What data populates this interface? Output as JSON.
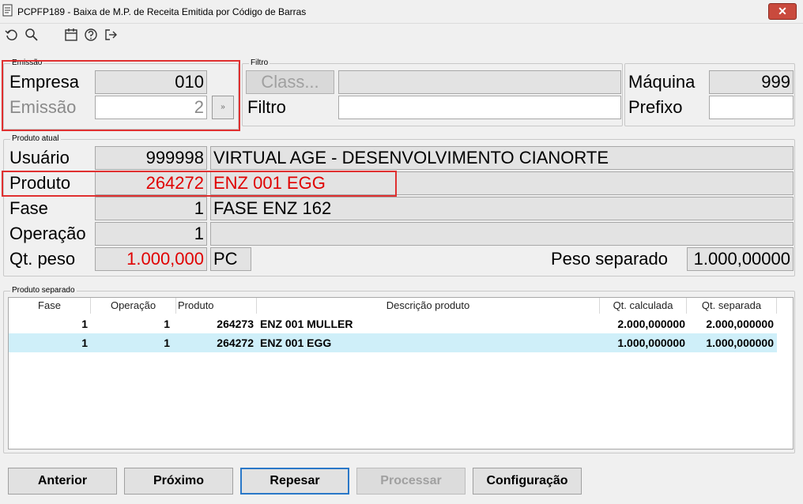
{
  "window": {
    "title": "PCPFP189 - Baixa de M.P. de Receita Emitida por Código de Barras",
    "close_label": "✕"
  },
  "toolbar": {
    "icons": [
      "refresh-icon",
      "search-icon",
      "calendar-icon",
      "help-icon",
      "exit-icon"
    ]
  },
  "emissao": {
    "legend": "Emissão",
    "empresa_label": "Empresa",
    "empresa_value": "010",
    "emissao_label": "Emissão",
    "emissao_value": "2",
    "lookup_label": "»"
  },
  "filtro": {
    "legend": "Filtro",
    "class_button": "Class...",
    "class_value": "",
    "filtro_label": "Filtro",
    "filtro_value": ""
  },
  "maquina": {
    "maquina_label": "Máquina",
    "maquina_value": "999",
    "prefixo_label": "Prefixo",
    "prefixo_value": ""
  },
  "produto_atual": {
    "legend": "Produto atual",
    "usuario_label": "Usuário",
    "usuario_code": "999998",
    "usuario_name": "VIRTUAL AGE - DESENVOLVIMENTO CIANORTE",
    "produto_label": "Produto",
    "produto_code": "264272",
    "produto_name": "ENZ 001 EGG",
    "fase_label": "Fase",
    "fase_code": "1",
    "fase_name": "FASE ENZ 162",
    "operacao_label": "Operação",
    "operacao_code": "1",
    "operacao_name": "",
    "qtpeso_label": "Qt. peso",
    "qtpeso_value": "1.000,000",
    "unit": "PC",
    "peso_separado_label": "Peso separado",
    "peso_separado_value": "1.000,00000"
  },
  "produto_separado": {
    "legend": "Produto separado",
    "columns": [
      "Fase",
      "Operação",
      "Produto",
      "Descrição produto",
      "Qt. calculada",
      "Qt. separada"
    ],
    "rows": [
      {
        "fase": "1",
        "operacao": "1",
        "produto": "264273",
        "descricao": "ENZ 001 MULLER",
        "qt_calculada": "2.000,000000",
        "qt_separada": "2.000,000000"
      },
      {
        "fase": "1",
        "operacao": "1",
        "produto": "264272",
        "descricao": "ENZ 001 EGG",
        "qt_calculada": "1.000,000000",
        "qt_separada": "1.000,000000"
      }
    ]
  },
  "buttons": {
    "anterior": "Anterior",
    "proximo": "Próximo",
    "repesar": "Repesar",
    "processar": "Processar",
    "configuracao": "Configuração"
  },
  "colors": {
    "highlight": "#e03030",
    "accent_red": "#e00000",
    "selected_row": "#cfeff9",
    "primary_border": "#2a78c8"
  }
}
